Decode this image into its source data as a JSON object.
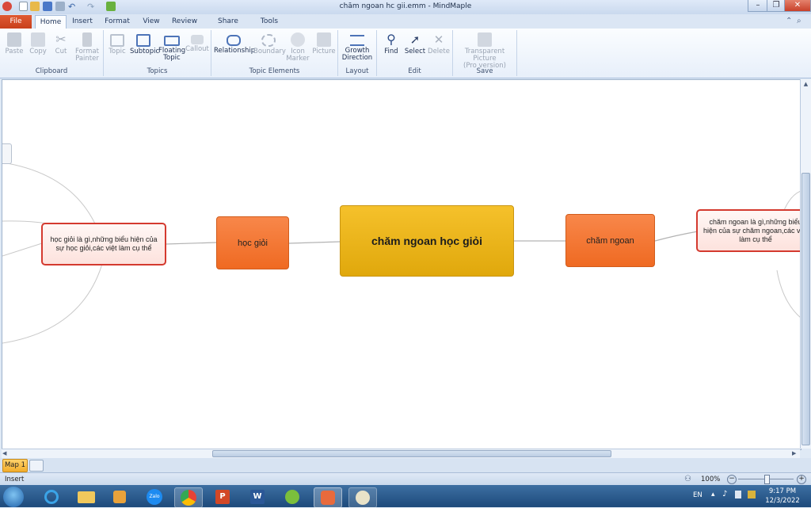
{
  "window": {
    "title": "chăm ngoan hc gii.emm - MindMaple"
  },
  "tabs": [
    {
      "label": "File"
    },
    {
      "label": "Home"
    },
    {
      "label": "Insert"
    },
    {
      "label": "Format"
    },
    {
      "label": "View"
    },
    {
      "label": "Review"
    },
    {
      "label": "Share (Beta)"
    },
    {
      "label": "Tools"
    }
  ],
  "ribbon": {
    "clipboard": {
      "label": "Clipboard",
      "paste": "Paste",
      "copy": "Copy",
      "cut": "Cut",
      "format_painter_1": "Format",
      "format_painter_2": "Painter"
    },
    "topics": {
      "label": "Topics",
      "topic": "Topic",
      "subtopic": "Subtopic",
      "floating_1": "Floating",
      "floating_2": "Topic",
      "callout": "Callout"
    },
    "elements": {
      "label": "Topic Elements",
      "relationship": "Relationship",
      "boundary": "Boundary",
      "icon_1": "Icon",
      "icon_2": "Marker",
      "picture": "Picture"
    },
    "layout": {
      "label": "Layout",
      "growth_1": "Growth",
      "growth_2": "Direction"
    },
    "edit": {
      "label": "Edit",
      "find": "Find",
      "select": "Select",
      "delete": "Delete"
    },
    "save": {
      "label": "Save",
      "tp_1": "Transparent Picture",
      "tp_2": "(Pro version)"
    }
  },
  "mindmap": {
    "central": "chăm ngoan học giỏi",
    "left_main": "học giỏi",
    "right_main": "chăm ngoan",
    "left_sub": "học giỏi là gì,những biểu hiện của sự học giỏi,các việt làm cụ thể",
    "right_sub": "chăm ngoan là gì,những biểu hiện của sự chăm ngoan,các việt làm cụ thể"
  },
  "maptab": {
    "label": "Map 1"
  },
  "status": {
    "mode": "Insert",
    "zoom": "100%"
  },
  "tray": {
    "lang": "EN",
    "time": "9:17 PM",
    "date": "12/3/2022"
  },
  "colors": {
    "central": "#eeb111",
    "main": "#f26b21",
    "sub_border": "#d43a2f",
    "file_tab": "#d14b22"
  }
}
